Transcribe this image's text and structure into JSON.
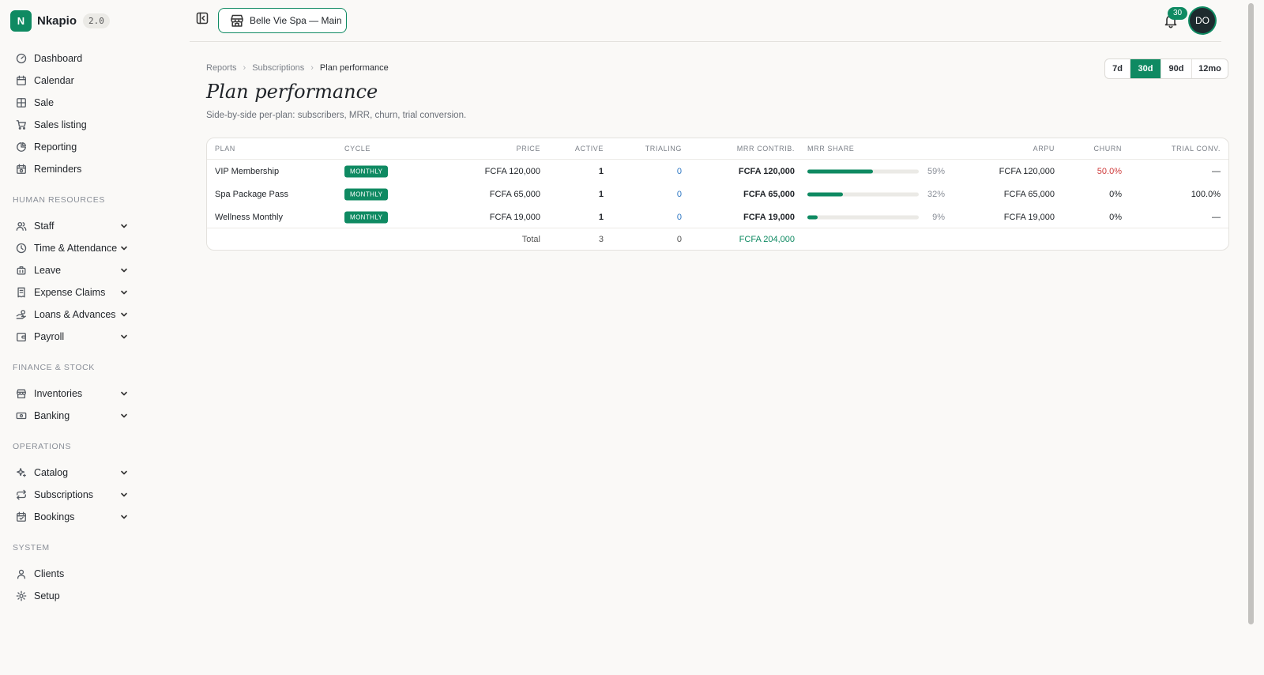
{
  "brand": {
    "initial": "N",
    "name": "Nkapio",
    "version": "2.0"
  },
  "sidebar": {
    "top_items": [
      {
        "label": "Dashboard",
        "icon": "dashboard-icon"
      },
      {
        "label": "Calendar",
        "icon": "calendar-icon"
      },
      {
        "label": "Sale",
        "icon": "grid-icon"
      },
      {
        "label": "Sales listing",
        "icon": "cart-icon"
      },
      {
        "label": "Reporting",
        "icon": "pie-chart-icon"
      },
      {
        "label": "Reminders",
        "icon": "alarm-icon"
      }
    ],
    "sections": [
      {
        "title": "HUMAN RESOURCES",
        "items": [
          {
            "label": "Staff",
            "icon": "users-icon"
          },
          {
            "label": "Time & Attendance",
            "icon": "clock-icon"
          },
          {
            "label": "Leave",
            "icon": "beach-icon"
          },
          {
            "label": "Expense Claims",
            "icon": "receipt-icon"
          },
          {
            "label": "Loans & Advances",
            "icon": "hand-coins-icon"
          },
          {
            "label": "Payroll",
            "icon": "wallet-icon"
          }
        ]
      },
      {
        "title": "FINANCE & STOCK",
        "items": [
          {
            "label": "Inventories",
            "icon": "store-icon"
          },
          {
            "label": "Banking",
            "icon": "banknote-icon"
          }
        ]
      },
      {
        "title": "OPERATIONS",
        "items": [
          {
            "label": "Catalog",
            "icon": "sparkles-icon"
          },
          {
            "label": "Subscriptions",
            "icon": "repeat-icon"
          },
          {
            "label": "Bookings",
            "icon": "calendar-check-icon"
          }
        ]
      },
      {
        "title": "SYSTEM",
        "items": [
          {
            "label": "Clients",
            "icon": "user-icon"
          },
          {
            "label": "Setup",
            "icon": "gear-icon"
          }
        ]
      }
    ]
  },
  "topbar": {
    "location": "Belle Vie Spa — Main",
    "notifications_count": "30",
    "avatar_initials": "DO"
  },
  "breadcrumb": [
    "Reports",
    "Subscriptions",
    "Plan performance"
  ],
  "ranges": [
    {
      "label": "7d",
      "active": false
    },
    {
      "label": "30d",
      "active": true
    },
    {
      "label": "90d",
      "active": false
    },
    {
      "label": "12mo",
      "active": false
    }
  ],
  "page": {
    "title": "Plan performance",
    "subtitle": "Side-by-side per-plan: subscribers, MRR, churn, trial conversion."
  },
  "table": {
    "headers": {
      "plan": "PLAN",
      "cycle": "CYCLE",
      "price": "PRICE",
      "active": "ACTIVE",
      "trialing": "TRIALING",
      "mrr": "MRR CONTRIB.",
      "share": "MRR SHARE",
      "arpu": "ARPU",
      "churn": "CHURN",
      "trial": "TRIAL CONV."
    },
    "rows": [
      {
        "plan": "VIP Membership",
        "cycle": "MONTHLY",
        "price": "FCFA 120,000",
        "active": "1",
        "trialing": "0",
        "mrr": "FCFA 120,000",
        "share_pct": 59,
        "share": "59%",
        "arpu": "FCFA 120,000",
        "churn": "50.0%",
        "churn_alert": true,
        "trial": "—"
      },
      {
        "plan": "Spa Package Pass",
        "cycle": "MONTHLY",
        "price": "FCFA 65,000",
        "active": "1",
        "trialing": "0",
        "mrr": "FCFA 65,000",
        "share_pct": 32,
        "share": "32%",
        "arpu": "FCFA 65,000",
        "churn": "0%",
        "churn_alert": false,
        "trial": "100.0%"
      },
      {
        "plan": "Wellness Monthly",
        "cycle": "MONTHLY",
        "price": "FCFA 19,000",
        "active": "1",
        "trialing": "0",
        "mrr": "FCFA 19,000",
        "share_pct": 9,
        "share": "9%",
        "arpu": "FCFA 19,000",
        "churn": "0%",
        "churn_alert": false,
        "trial": "—"
      }
    ],
    "total": {
      "label": "Total",
      "active": "3",
      "trialing": "0",
      "mrr": "FCFA 204,000"
    }
  },
  "colors": {
    "accent": "#0f8a62",
    "link": "#2f78c4",
    "danger": "#cf3b3b"
  }
}
